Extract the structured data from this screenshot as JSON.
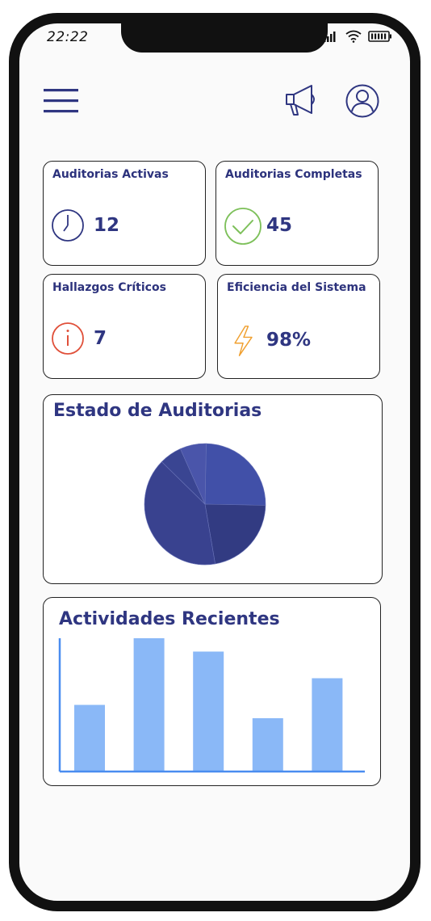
{
  "status_bar": {
    "time": "22:22"
  },
  "header": {
    "menu_icon": "menu-icon",
    "announce_icon": "megaphone-icon",
    "profile_icon": "user-icon"
  },
  "colors": {
    "primary": "#2f3681",
    "danger": "#e0503a",
    "success": "#7dc05a",
    "warning": "#f0a030",
    "bar": "#8ab8f7"
  },
  "stats": [
    {
      "title": "Auditorias Activas",
      "value": "12",
      "icon": "clock-icon"
    },
    {
      "title": "Auditorias Completas",
      "value": "45",
      "icon": "check-circle-icon"
    },
    {
      "title": "Hallazgos Críticos",
      "value": "7",
      "icon": "info-icon"
    },
    {
      "title": "Eficiencia del Sistema",
      "value": "98%",
      "icon": "lightning-icon"
    }
  ],
  "audit_status": {
    "title": "Estado de Auditorias"
  },
  "recent_activity": {
    "title": "Actividades Recientes"
  },
  "chart_data": [
    {
      "type": "pie",
      "title": "Estado de Auditorias",
      "values": [
        25,
        22,
        40,
        6,
        7
      ],
      "colors": [
        "#4150a8",
        "#323b82",
        "#39428f",
        "#3a4592",
        "#4a55aa"
      ]
    },
    {
      "type": "bar",
      "title": "Actividades Recientes",
      "categories": [
        "",
        "",
        "",
        "",
        ""
      ],
      "values": [
        50,
        100,
        90,
        40,
        70
      ],
      "ylim": [
        0,
        100
      ],
      "grid": false
    }
  ]
}
